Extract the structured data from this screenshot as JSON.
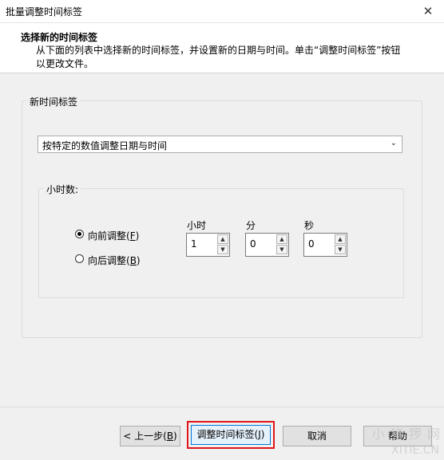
{
  "window": {
    "title": "批量调整时间标签"
  },
  "header": {
    "heading": "选择新的时间标签",
    "description": "从下面的列表中选择新的时间标签，并设置新的日期与时间。单击“调整时间标签”按钮以更改文件。"
  },
  "group_new_tag": {
    "label": "新时间标签",
    "combo_value": "按特定的数值调整日期与时间"
  },
  "group_hours": {
    "label": "小时数:",
    "radio_forward": {
      "text": "向前调整(",
      "key": "F",
      "end": ")",
      "checked": true
    },
    "radio_backward": {
      "text": "向后调整(",
      "key": "B",
      "end": ")",
      "checked": false
    },
    "spin_hour": {
      "label": "小时",
      "value": "1"
    },
    "spin_minute": {
      "label": "分",
      "value": "0"
    },
    "spin_second": {
      "label": "秒",
      "value": "0"
    }
  },
  "buttons": {
    "back": {
      "text": "< 上一步(",
      "key": "B",
      "end": ")"
    },
    "adjust": {
      "text": "调整时间标签(",
      "key": "J",
      "end": ")"
    },
    "cancel": "取消",
    "help": "帮助"
  },
  "watermark": {
    "line1": "小 猪 猡 网",
    "line2": "XITIE.CN"
  },
  "icons": {
    "close": "close-icon",
    "combo": "chevron-down-icon"
  }
}
